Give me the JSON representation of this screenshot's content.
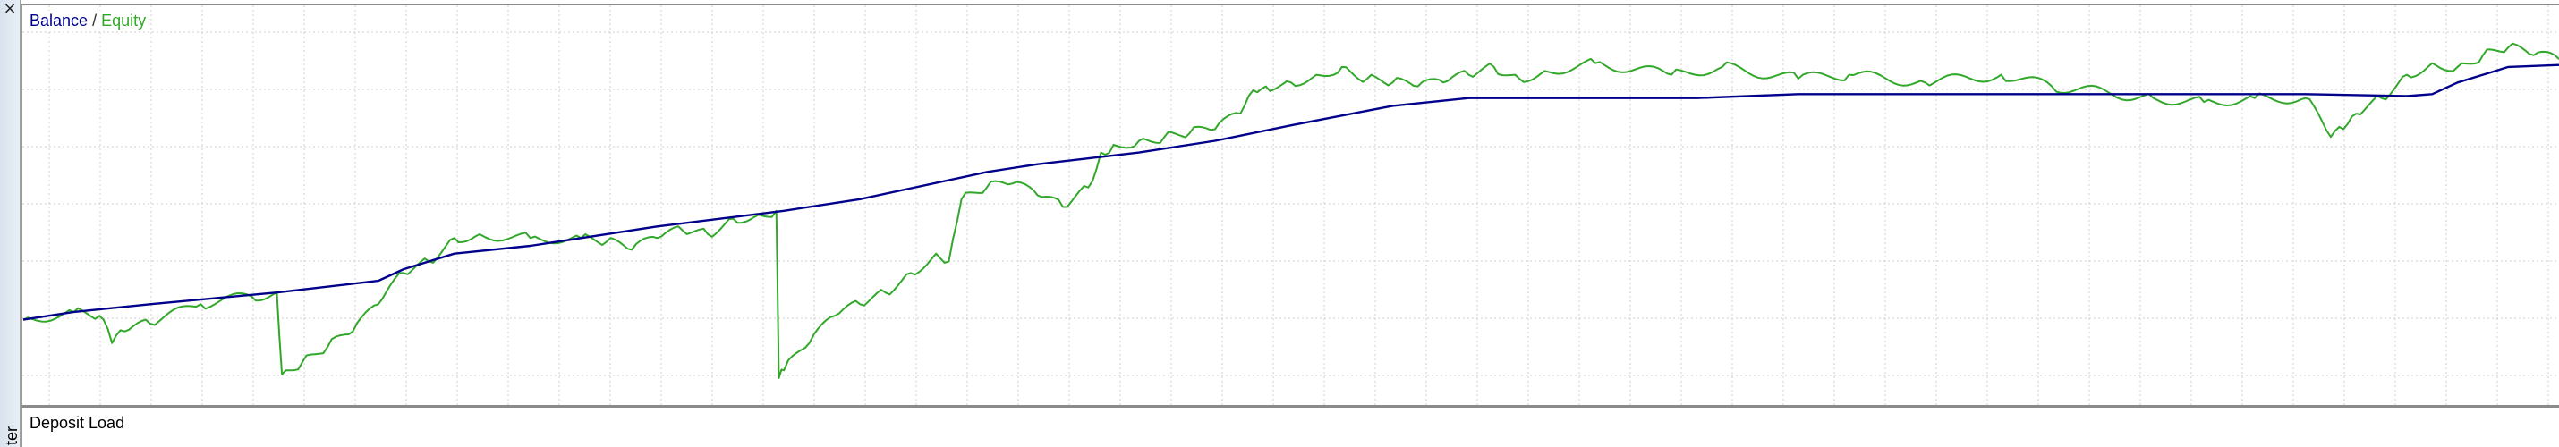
{
  "window": {
    "close_glyph": "×",
    "side_tab_label": "ter"
  },
  "chart_data": {
    "type": "line",
    "title": "",
    "legend": {
      "placement": "top-left",
      "separator": "/"
    },
    "grid": true,
    "xlim": [
      0,
      100
    ],
    "ylim": [
      0,
      100
    ],
    "series": [
      {
        "name": "Balance",
        "color": "#00008b",
        "x": [
          0,
          2,
          5,
          10,
          14,
          15,
          17,
          20,
          22,
          25,
          30,
          33,
          38,
          40,
          44,
          47,
          50,
          54,
          57,
          66,
          70,
          75,
          81,
          86,
          90,
          94,
          95,
          96,
          97,
          98,
          100
        ],
        "y": [
          21,
          23,
          25,
          28,
          31,
          34,
          38,
          40,
          42,
          45,
          49,
          52,
          59,
          61,
          64,
          67,
          71,
          76,
          78,
          78,
          79,
          79,
          79,
          79,
          79,
          78.5,
          79,
          82,
          84,
          86,
          86.5
        ]
      },
      {
        "name": "Equity",
        "color": "#32a82a",
        "x": [
          0,
          2,
          3,
          3.5,
          4,
          5,
          7,
          9,
          10,
          10.2,
          11,
          12,
          13,
          14,
          15,
          16,
          17,
          18,
          20,
          22,
          23,
          24,
          25,
          26,
          27,
          28,
          29,
          29.7,
          29.8,
          30,
          31,
          32,
          33,
          34,
          35,
          36,
          36.5,
          37,
          38,
          39,
          40,
          41,
          42,
          42.5,
          43,
          44,
          45,
          46,
          47,
          48,
          48.5,
          49,
          50,
          51,
          52,
          53,
          54,
          55,
          56,
          57,
          58,
          59,
          60,
          62,
          65,
          67,
          70,
          72,
          75,
          78,
          80,
          84,
          86,
          88,
          90,
          91,
          91.5,
          92,
          93,
          94,
          95,
          96,
          97,
          98,
          99,
          100
        ],
        "y": [
          21,
          23,
          22,
          15,
          18,
          20,
          25,
          27,
          28,
          7,
          10,
          14,
          18,
          25,
          33,
          36,
          42,
          43,
          42,
          42,
          41,
          39,
          42,
          44,
          43,
          47,
          48,
          49,
          6,
          8,
          15,
          22,
          25,
          28,
          33,
          38,
          36,
          52,
          55,
          56,
          53,
          50,
          55,
          64,
          66,
          67,
          68,
          69,
          70,
          74,
          80,
          81,
          82,
          84,
          86,
          83,
          82,
          81,
          82,
          84,
          86,
          83,
          85,
          87,
          84,
          86,
          83,
          84,
          82,
          84,
          81,
          78,
          77,
          78,
          78,
          68,
          70,
          74,
          78,
          84,
          87,
          86,
          89,
          91,
          89,
          88
        ]
      }
    ]
  },
  "lower_panel": {
    "title": "Deposit Load"
  }
}
